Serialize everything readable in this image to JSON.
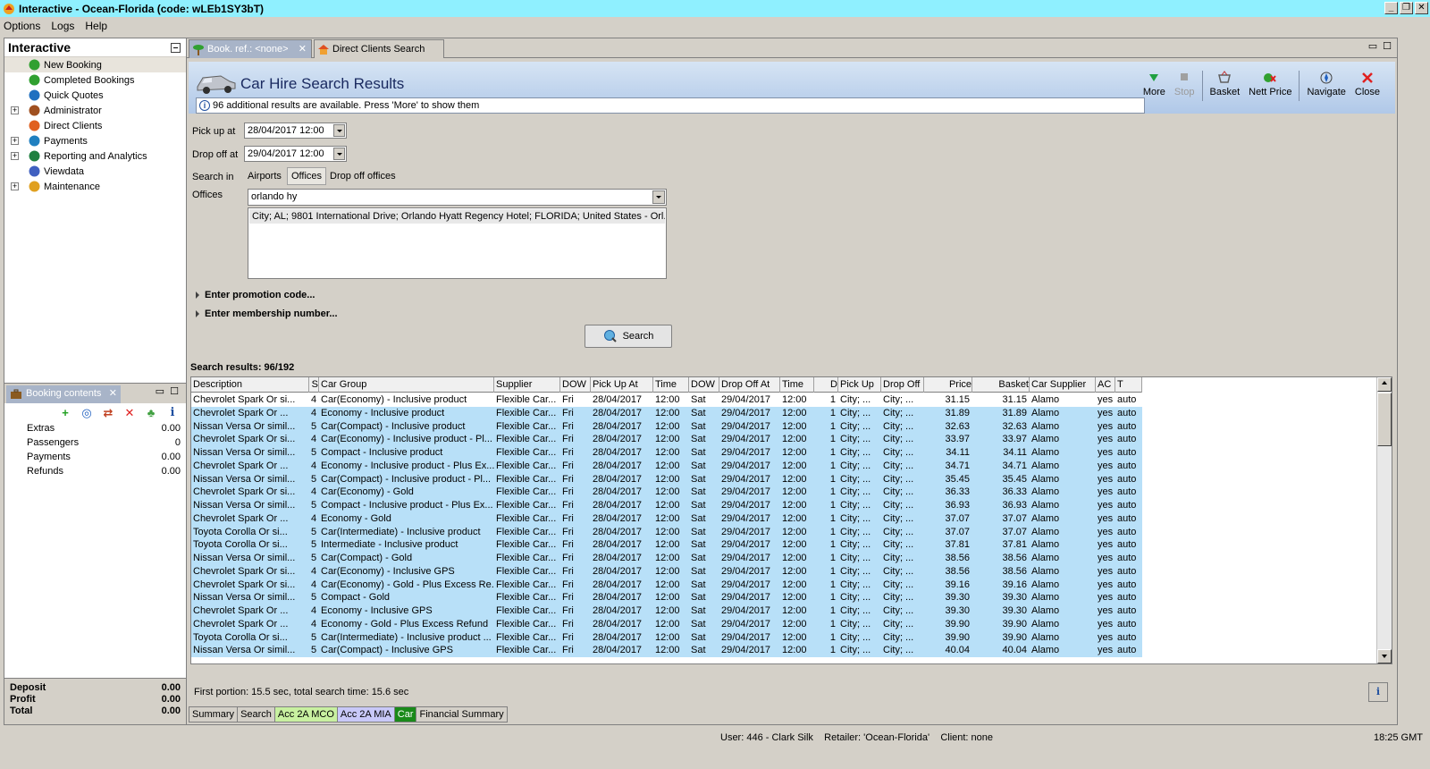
{
  "window": {
    "title": "Interactive - Ocean-Florida (code: wLEb1SY3bT)",
    "controls": [
      "_",
      "❐",
      "✕"
    ]
  },
  "menu": {
    "options": "Options",
    "logs": "Logs",
    "help": "Help"
  },
  "nav": {
    "title": "Interactive",
    "items": [
      {
        "label": "New Booking",
        "expandable": false
      },
      {
        "label": "Completed Bookings",
        "expandable": false
      },
      {
        "label": "Quick Quotes",
        "expandable": false
      },
      {
        "label": "Administrator",
        "expandable": true
      },
      {
        "label": "Direct Clients",
        "expandable": false
      },
      {
        "label": "Payments",
        "expandable": true
      },
      {
        "label": "Reporting and Analytics",
        "expandable": true
      },
      {
        "label": "Viewdata",
        "expandable": false
      },
      {
        "label": "Maintenance",
        "expandable": true
      }
    ]
  },
  "booking_contents": {
    "tab_label": "Booking contents",
    "rows": [
      {
        "label": "Extras",
        "value": "0.00"
      },
      {
        "label": "Passengers",
        "value": "0"
      },
      {
        "label": "Payments",
        "value": "0.00"
      },
      {
        "label": "Refunds",
        "value": "0.00"
      }
    ],
    "totals": [
      {
        "label": "Deposit",
        "value": "0.00"
      },
      {
        "label": "Profit",
        "value": "0.00"
      },
      {
        "label": "Total",
        "value": "0.00"
      }
    ]
  },
  "doc_tabs": {
    "active": "Book. ref.: <none>",
    "other": "Direct Clients Search"
  },
  "page": {
    "title": "Car Hire Search Results",
    "info": "96 additional results are available. Press 'More' to show them"
  },
  "toolbar": {
    "more": "More",
    "stop": "Stop",
    "basket": "Basket",
    "nett_price": "Nett Price",
    "navigate": "Navigate",
    "close": "Close"
  },
  "form": {
    "pickup_label": "Pick up at",
    "pickup_value": "28/04/2017 12:00",
    "dropoff_label": "Drop off at",
    "dropoff_value": "29/04/2017 12:00",
    "search_in_label": "Search in",
    "search_in_options": [
      "Airports",
      "Offices",
      "Drop off offices"
    ],
    "search_in_selected": "Offices",
    "offices_label": "Offices",
    "offices_value": "orlando hy",
    "office_result": "City; AL; 9801 International Drive; Orlando Hyatt Regency Hotel; FLORIDA; United States - Orl...",
    "promo": "Enter promotion code...",
    "membership": "Enter membership number...",
    "search_button": "Search"
  },
  "results": {
    "label": "Search results: 96/192",
    "columns": [
      "Description",
      "S",
      "Car Group",
      "Supplier",
      "DOW",
      "Pick Up At",
      "Time",
      "DOW",
      "Drop Off At",
      "Time",
      "D",
      "Pick Up",
      "Drop Off",
      "Price",
      "Basket",
      "Car Supplier",
      "AC",
      "T"
    ],
    "rows": [
      [
        "Chevrolet Spark Or si...",
        "4",
        "Car(Economy) - Inclusive product",
        "Flexible Car...",
        "Fri",
        "28/04/2017",
        "12:00",
        "Sat",
        "29/04/2017",
        "12:00",
        "1",
        "City; ...",
        "City; ...",
        "31.15",
        "31.15",
        "Alamo",
        "yes",
        "auto"
      ],
      [
        "Chevrolet  Spark Or ...",
        "4",
        "Economy - Inclusive product",
        "Flexible Car...",
        "Fri",
        "28/04/2017",
        "12:00",
        "Sat",
        "29/04/2017",
        "12:00",
        "1",
        "City; ...",
        "City; ...",
        "31.89",
        "31.89",
        "Alamo",
        "yes",
        "auto"
      ],
      [
        "Nissan Versa Or simil...",
        "5",
        "Car(Compact) - Inclusive product",
        "Flexible Car...",
        "Fri",
        "28/04/2017",
        "12:00",
        "Sat",
        "29/04/2017",
        "12:00",
        "1",
        "City; ...",
        "City; ...",
        "32.63",
        "32.63",
        "Alamo",
        "yes",
        "auto"
      ],
      [
        "Chevrolet Spark Or si...",
        "4",
        "Car(Economy) - Inclusive product - Pl...",
        "Flexible Car...",
        "Fri",
        "28/04/2017",
        "12:00",
        "Sat",
        "29/04/2017",
        "12:00",
        "1",
        "City; ...",
        "City; ...",
        "33.97",
        "33.97",
        "Alamo",
        "yes",
        "auto"
      ],
      [
        "Nissan Versa Or simil...",
        "5",
        "Compact - Inclusive product",
        "Flexible Car...",
        "Fri",
        "28/04/2017",
        "12:00",
        "Sat",
        "29/04/2017",
        "12:00",
        "1",
        "City; ...",
        "City; ...",
        "34.11",
        "34.11",
        "Alamo",
        "yes",
        "auto"
      ],
      [
        "Chevrolet  Spark Or ...",
        "4",
        "Economy - Inclusive product - Plus Ex...",
        "Flexible Car...",
        "Fri",
        "28/04/2017",
        "12:00",
        "Sat",
        "29/04/2017",
        "12:00",
        "1",
        "City; ...",
        "City; ...",
        "34.71",
        "34.71",
        "Alamo",
        "yes",
        "auto"
      ],
      [
        "Nissan Versa Or simil...",
        "5",
        "Car(Compact) - Inclusive product - Pl...",
        "Flexible Car...",
        "Fri",
        "28/04/2017",
        "12:00",
        "Sat",
        "29/04/2017",
        "12:00",
        "1",
        "City; ...",
        "City; ...",
        "35.45",
        "35.45",
        "Alamo",
        "yes",
        "auto"
      ],
      [
        "Chevrolet Spark Or si...",
        "4",
        "Car(Economy) - Gold",
        "Flexible Car...",
        "Fri",
        "28/04/2017",
        "12:00",
        "Sat",
        "29/04/2017",
        "12:00",
        "1",
        "City; ...",
        "City; ...",
        "36.33",
        "36.33",
        "Alamo",
        "yes",
        "auto"
      ],
      [
        "Nissan Versa Or simil...",
        "5",
        "Compact - Inclusive product - Plus Ex...",
        "Flexible Car...",
        "Fri",
        "28/04/2017",
        "12:00",
        "Sat",
        "29/04/2017",
        "12:00",
        "1",
        "City; ...",
        "City; ...",
        "36.93",
        "36.93",
        "Alamo",
        "yes",
        "auto"
      ],
      [
        "Chevrolet  Spark Or ...",
        "4",
        "Economy - Gold",
        "Flexible Car...",
        "Fri",
        "28/04/2017",
        "12:00",
        "Sat",
        "29/04/2017",
        "12:00",
        "1",
        "City; ...",
        "City; ...",
        "37.07",
        "37.07",
        "Alamo",
        "yes",
        "auto"
      ],
      [
        "Toyota Corolla Or si...",
        "5",
        "Car(Intermediate) - Inclusive product",
        "Flexible Car...",
        "Fri",
        "28/04/2017",
        "12:00",
        "Sat",
        "29/04/2017",
        "12:00",
        "1",
        "City; ...",
        "City; ...",
        "37.07",
        "37.07",
        "Alamo",
        "yes",
        "auto"
      ],
      [
        "Toyota Corolla Or si...",
        "5",
        "Intermediate - Inclusive product",
        "Flexible Car...",
        "Fri",
        "28/04/2017",
        "12:00",
        "Sat",
        "29/04/2017",
        "12:00",
        "1",
        "City; ...",
        "City; ...",
        "37.81",
        "37.81",
        "Alamo",
        "yes",
        "auto"
      ],
      [
        "Nissan Versa Or simil...",
        "5",
        "Car(Compact) - Gold",
        "Flexible Car...",
        "Fri",
        "28/04/2017",
        "12:00",
        "Sat",
        "29/04/2017",
        "12:00",
        "1",
        "City; ...",
        "City; ...",
        "38.56",
        "38.56",
        "Alamo",
        "yes",
        "auto"
      ],
      [
        "Chevrolet Spark Or si...",
        "4",
        "Car(Economy) - Inclusive GPS",
        "Flexible Car...",
        "Fri",
        "28/04/2017",
        "12:00",
        "Sat",
        "29/04/2017",
        "12:00",
        "1",
        "City; ...",
        "City; ...",
        "38.56",
        "38.56",
        "Alamo",
        "yes",
        "auto"
      ],
      [
        "Chevrolet Spark Or si...",
        "4",
        "Car(Economy) - Gold - Plus Excess Re...",
        "Flexible Car...",
        "Fri",
        "28/04/2017",
        "12:00",
        "Sat",
        "29/04/2017",
        "12:00",
        "1",
        "City; ...",
        "City; ...",
        "39.16",
        "39.16",
        "Alamo",
        "yes",
        "auto"
      ],
      [
        "Nissan Versa Or simil...",
        "5",
        "Compact - Gold",
        "Flexible Car...",
        "Fri",
        "28/04/2017",
        "12:00",
        "Sat",
        "29/04/2017",
        "12:00",
        "1",
        "City; ...",
        "City; ...",
        "39.30",
        "39.30",
        "Alamo",
        "yes",
        "auto"
      ],
      [
        "Chevrolet  Spark Or ...",
        "4",
        "Economy - Inclusive GPS",
        "Flexible Car...",
        "Fri",
        "28/04/2017",
        "12:00",
        "Sat",
        "29/04/2017",
        "12:00",
        "1",
        "City; ...",
        "City; ...",
        "39.30",
        "39.30",
        "Alamo",
        "yes",
        "auto"
      ],
      [
        "Chevrolet  Spark Or ...",
        "4",
        "Economy - Gold - Plus Excess Refund",
        "Flexible Car...",
        "Fri",
        "28/04/2017",
        "12:00",
        "Sat",
        "29/04/2017",
        "12:00",
        "1",
        "City; ...",
        "City; ...",
        "39.90",
        "39.90",
        "Alamo",
        "yes",
        "auto"
      ],
      [
        "Toyota Corolla Or si...",
        "5",
        "Car(Intermediate) - Inclusive product ...",
        "Flexible Car...",
        "Fri",
        "28/04/2017",
        "12:00",
        "Sat",
        "29/04/2017",
        "12:00",
        "1",
        "City; ...",
        "City; ...",
        "39.90",
        "39.90",
        "Alamo",
        "yes",
        "auto"
      ],
      [
        "Nissan Versa Or simil...",
        "5",
        "Car(Compact) - Inclusive GPS",
        "Flexible Car...",
        "Fri",
        "28/04/2017",
        "12:00",
        "Sat",
        "29/04/2017",
        "12:00",
        "1",
        "City; ...",
        "City; ...",
        "40.04",
        "40.04",
        "Alamo",
        "yes",
        "auto"
      ]
    ],
    "timing": "First portion: 15.5 sec, total search time: 15.6 sec"
  },
  "bottom_tabs": [
    {
      "label": "Summary",
      "color": "#d4d0c8",
      "fg": "#000000"
    },
    {
      "label": "Search",
      "color": "#d4d0c8",
      "fg": "#000000"
    },
    {
      "label": "Acc 2A MCO",
      "color": "#c8f0a0",
      "fg": "#000000"
    },
    {
      "label": "Acc 2A MIA",
      "color": "#c8c8f8",
      "fg": "#000000"
    },
    {
      "label": "Car",
      "color": "#1a8a1a",
      "fg": "#ffffff"
    },
    {
      "label": "Financial Summary",
      "color": "#d4d0c8",
      "fg": "#000000"
    }
  ],
  "statusbar": {
    "user": "User: 446 - Clark Silk",
    "retailer": "Retailer: 'Ocean-Florida'",
    "client": "Client: none",
    "clock": "18:25 GMT"
  }
}
